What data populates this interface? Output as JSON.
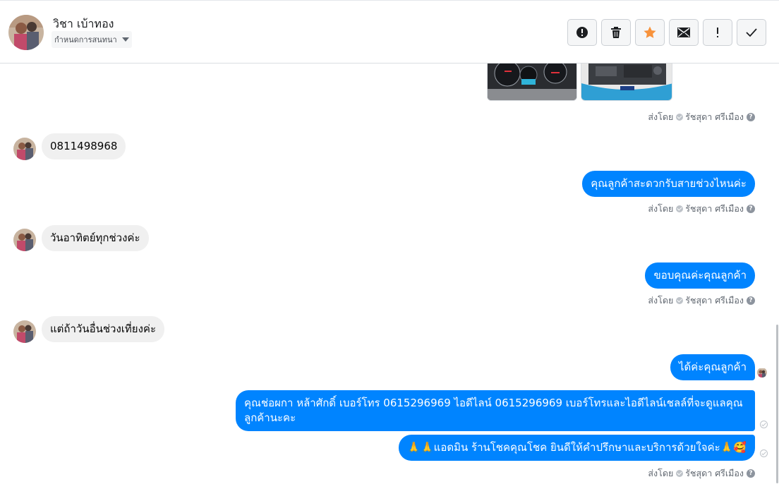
{
  "header": {
    "contact_name": "วิชา เบ้าทอง",
    "assign_label": "กำหนดการสนทนา",
    "actions": [
      {
        "icon": "alert-circle-icon",
        "name": "spam-button"
      },
      {
        "icon": "trash-icon",
        "name": "delete-button"
      },
      {
        "icon": "star-icon",
        "name": "star-button",
        "color": "#f7923b"
      },
      {
        "icon": "envelope-icon",
        "name": "mark-unread-button"
      },
      {
        "icon": "exclamation-icon",
        "name": "follow-up-button"
      },
      {
        "icon": "checkmark-icon",
        "name": "done-button"
      }
    ]
  },
  "colors": {
    "accent": "#0084ff",
    "incoming_bubble": "#f0f0f0",
    "star": "#f7923b"
  },
  "messages": [
    {
      "type": "image-attachment",
      "direction": "out",
      "images": [
        "dashboard-gauges-photo",
        "engine-bay-photo"
      ]
    },
    {
      "type": "sent-by",
      "prefix": "ส่งโดย",
      "agent": "รัชสุดา ศรีเมือง"
    },
    {
      "type": "text",
      "direction": "in",
      "text": "0811498968"
    },
    {
      "type": "text",
      "direction": "out",
      "text": "คุณลูกค้าสะดวกรับสายช่วงไหนค่ะ"
    },
    {
      "type": "sent-by",
      "prefix": "ส่งโดย",
      "agent": "รัชสุดา ศรีเมือง"
    },
    {
      "type": "text",
      "direction": "in",
      "text": "วันอาทิตย์ทุกช่วงค่ะ"
    },
    {
      "type": "text",
      "direction": "out",
      "text": "ขอบคุณค่ะคุณลูกค้า"
    },
    {
      "type": "sent-by",
      "prefix": "ส่งโดย",
      "agent": "รัชสุดา ศรีเมือง"
    },
    {
      "type": "text",
      "direction": "in",
      "text": "แต่ถ้าวันอื่นช่วงเที่ยงค่ะ"
    },
    {
      "type": "text",
      "direction": "out",
      "text": "ได้ค่ะคุณลูกค้า"
    },
    {
      "type": "text",
      "direction": "out",
      "text": "คุณช่อผกา หล้าศักดิ์      เบอร์โทร 0615296969  ไอดีไลน์ 0615296969   เบอร์โทรและไอดีไลน์เชลล์ที่จะดูแลคุณลูกค้านะคะ"
    },
    {
      "type": "text",
      "direction": "out",
      "text": "🙏🙏แอดมิน ร้านโชคคุณโชค ยินดีให้คำปรึกษาและบริการด้วยใจค่ะ🙏🥰"
    },
    {
      "type": "sent-by",
      "prefix": "ส่งโดย",
      "agent": "รัชสุดา ศรีเมือง"
    }
  ]
}
